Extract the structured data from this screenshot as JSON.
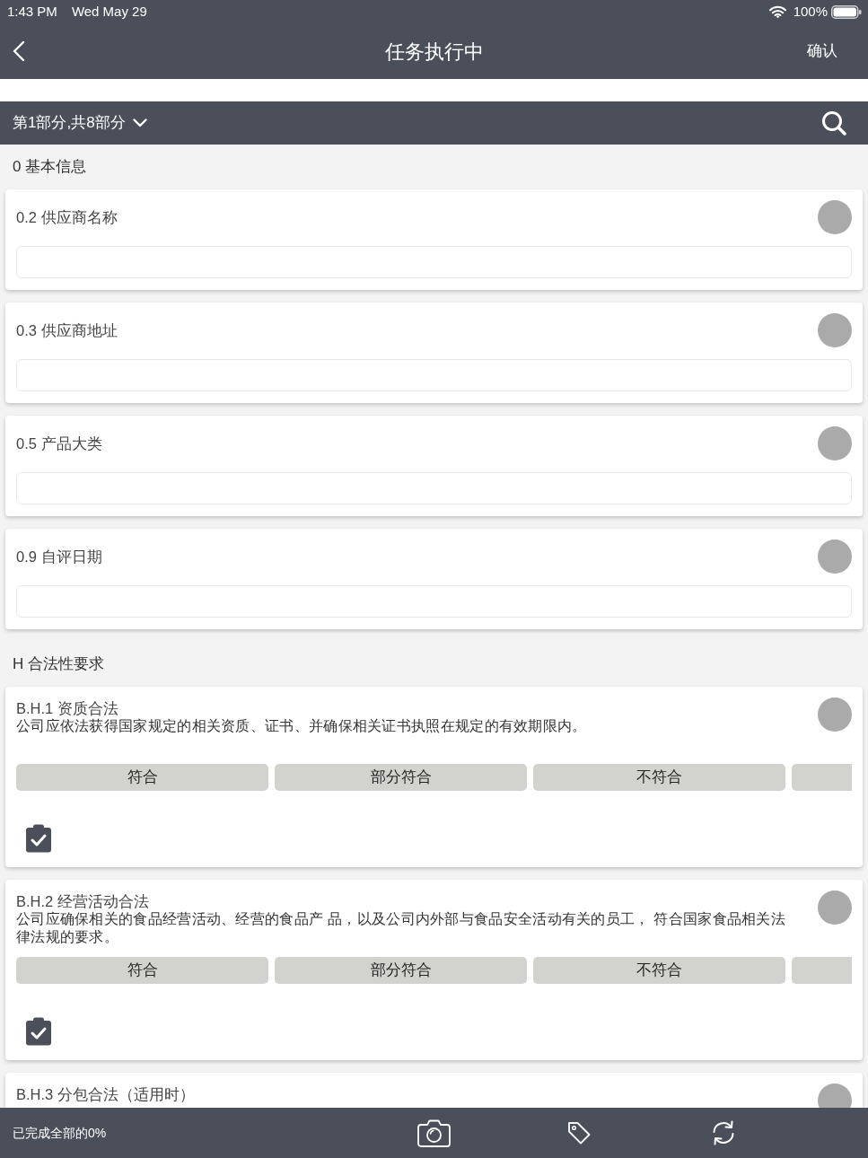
{
  "status_bar": {
    "time": "1:43 PM",
    "date": "Wed May 29",
    "battery": "100%"
  },
  "nav_bar": {
    "title": "任务执行中",
    "confirm": "确认"
  },
  "part_selector": {
    "label": "第1部分,共8部分"
  },
  "sections": [
    {
      "title": "0 基本信息",
      "items": [
        {
          "kind": "text",
          "label": "0.2 供应商名称"
        },
        {
          "kind": "text",
          "label": "0.3 供应商地址"
        },
        {
          "kind": "text",
          "label": "0.5 产品大类"
        },
        {
          "kind": "text",
          "label": "0.9 自评日期"
        }
      ]
    },
    {
      "title": "H 合法性要求",
      "items": [
        {
          "kind": "choice",
          "label": "B.H.1 资质合法",
          "description": "公司应依法获得国家规定的相关资质、证书、并确保相关证书执照在规定的有效期限内。",
          "options": [
            "符合",
            "部分符合",
            "不符合"
          ],
          "options_cut_off": true
        },
        {
          "kind": "choice",
          "label": "B.H.2 经营活动合法",
          "description": "公司应确保相关的食品经营活动、经营的食品产 品，以及公司内外部与食品安全活动有关的员工， 符合国家食品相关法律法规的要求。",
          "options": [
            "符合",
            "部分符合",
            "不符合"
          ],
          "options_cut_off": true
        },
        {
          "kind": "choice",
          "label": "B.H.3 分包合法（适用时）"
        }
      ]
    }
  ],
  "footer": {
    "progress": "已完成全部的0%"
  }
}
